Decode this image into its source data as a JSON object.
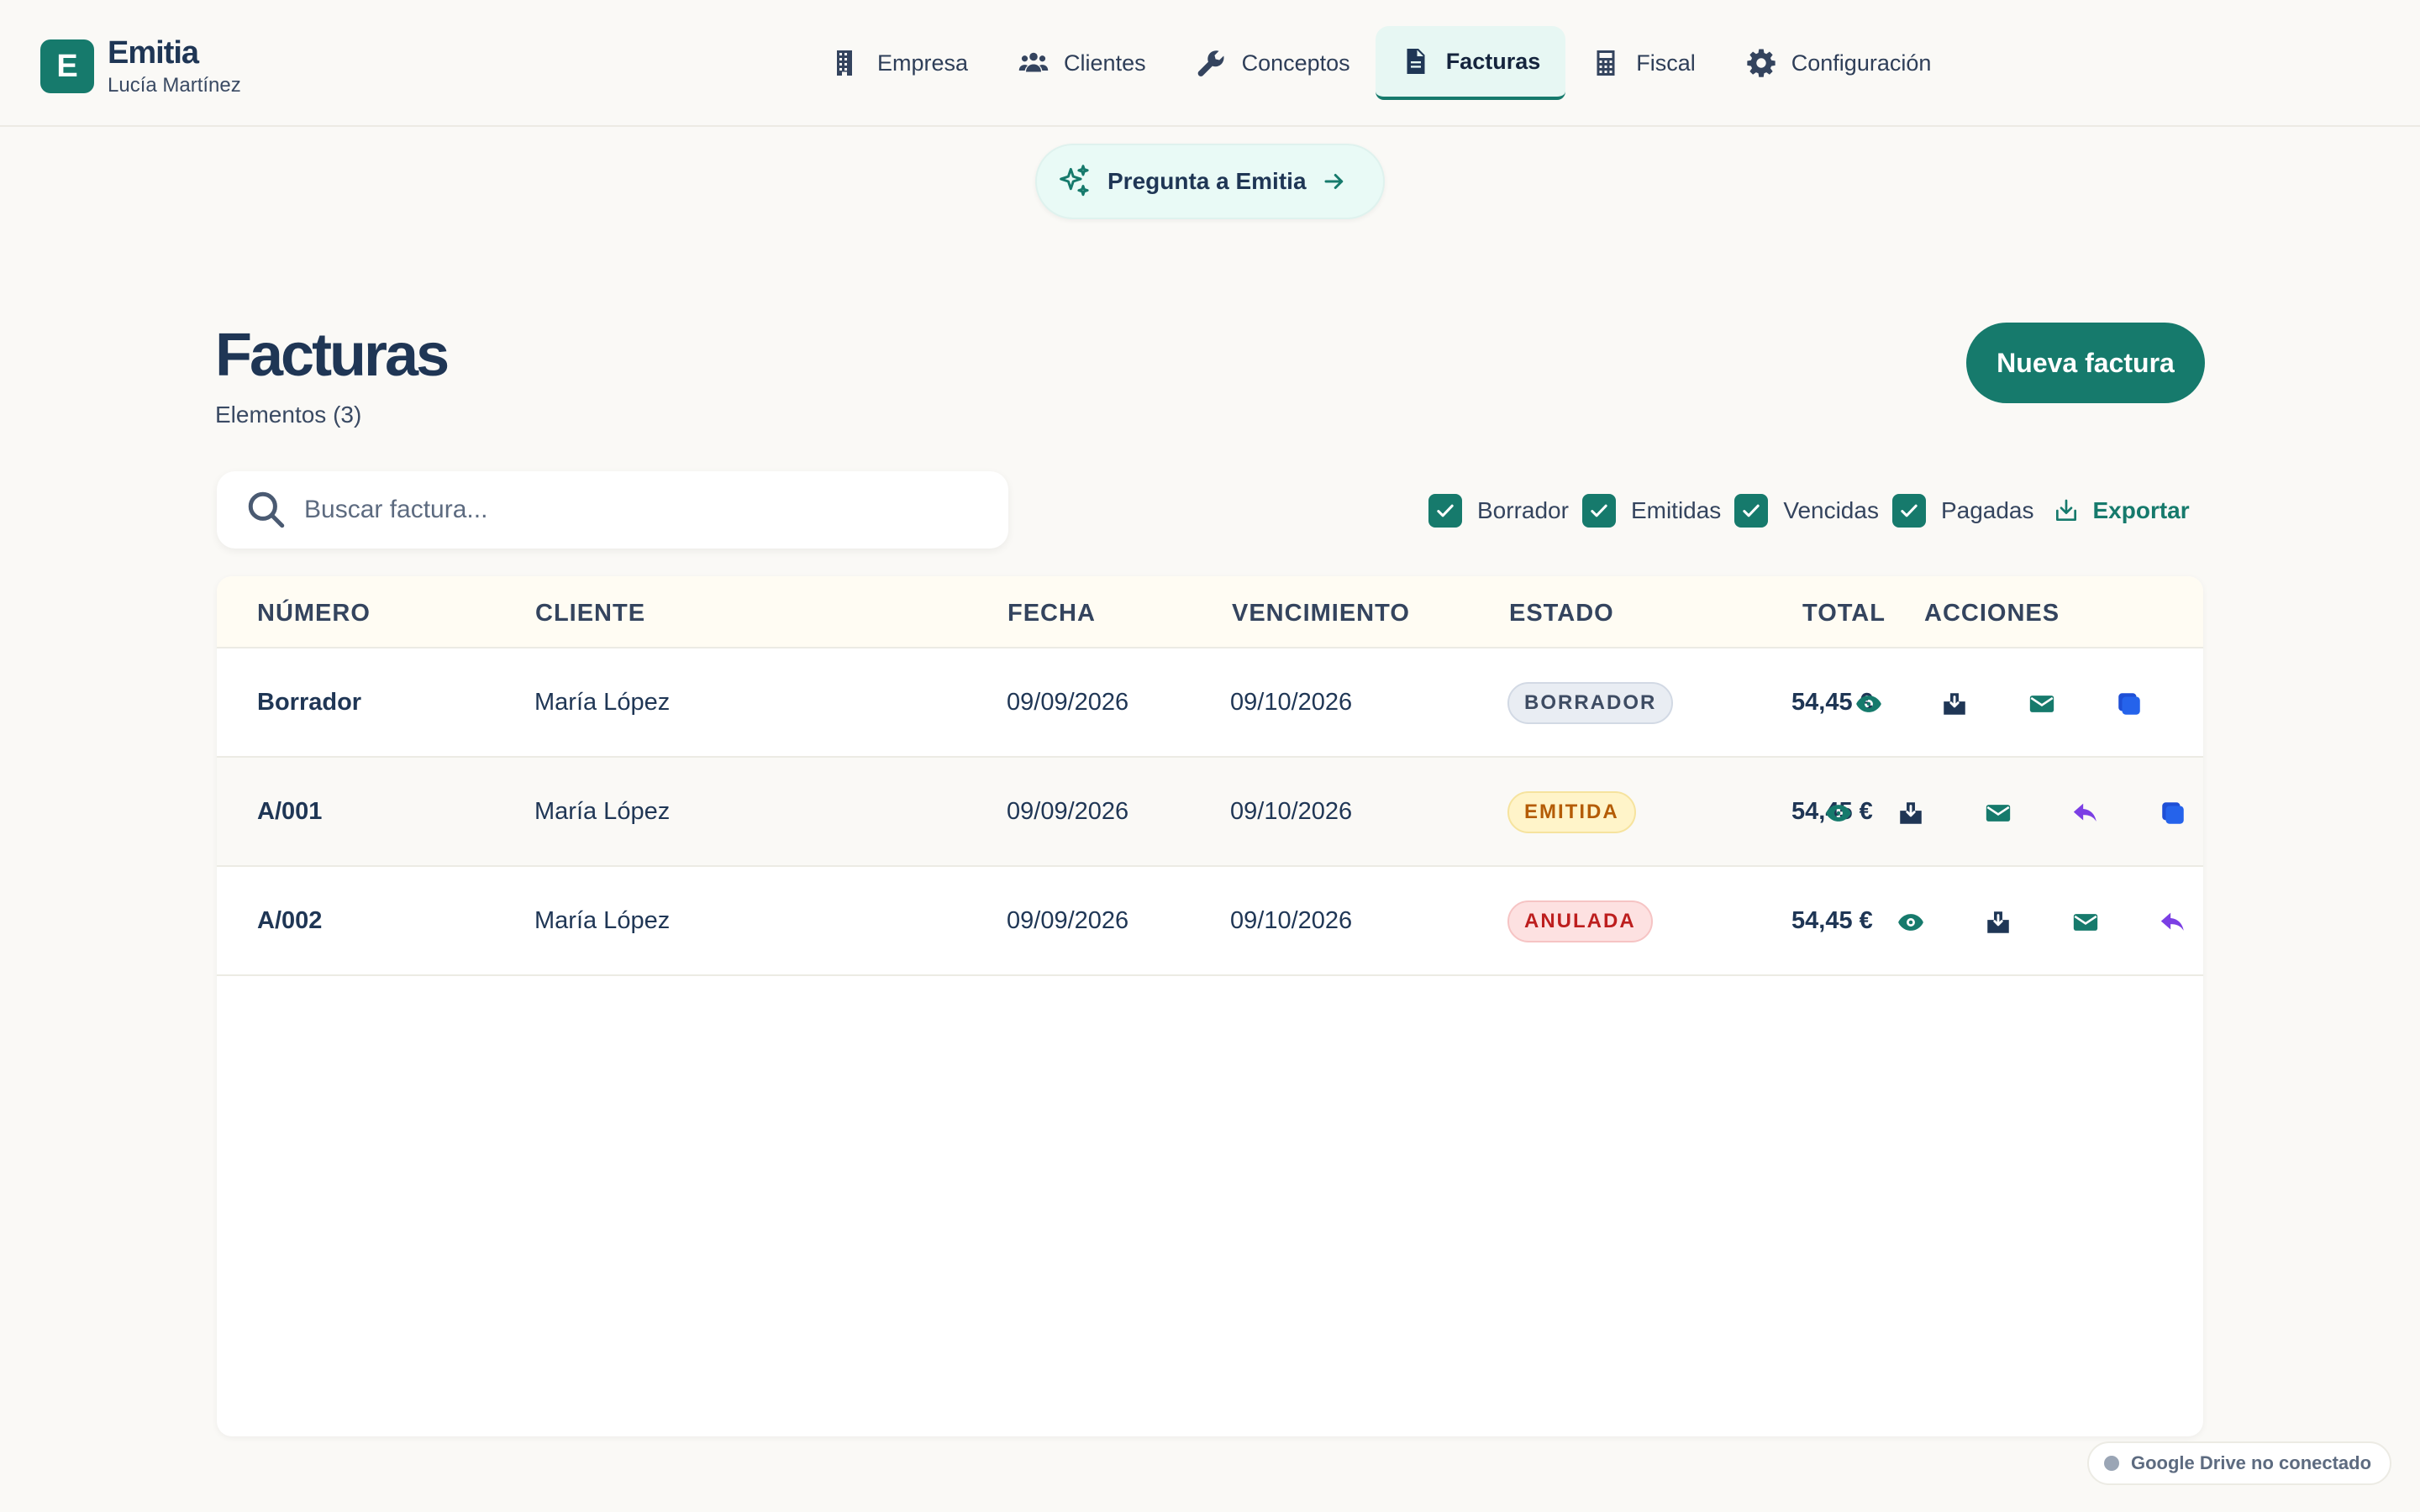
{
  "app": {
    "logo_letter": "E",
    "name": "Emitia",
    "user": "Lucía Martínez"
  },
  "nav": [
    {
      "label": "Empresa",
      "icon": "building-icon",
      "active": false
    },
    {
      "label": "Clientes",
      "icon": "users-icon",
      "active": false
    },
    {
      "label": "Conceptos",
      "icon": "wrench-icon",
      "active": false
    },
    {
      "label": "Facturas",
      "icon": "document-icon",
      "active": true
    },
    {
      "label": "Fiscal",
      "icon": "calculator-icon",
      "active": false
    },
    {
      "label": "Configuración",
      "icon": "gear-icon",
      "active": false
    }
  ],
  "ask": {
    "label": "Pregunta a Emitia"
  },
  "page": {
    "title": "Facturas",
    "count": "Elementos (3)",
    "new_button": "Nueva factura"
  },
  "search": {
    "placeholder": "Buscar factura...",
    "value": ""
  },
  "filters": [
    {
      "label": "Borrador",
      "checked": true
    },
    {
      "label": "Emitidas",
      "checked": true
    },
    {
      "label": "Vencidas",
      "checked": true
    },
    {
      "label": "Pagadas",
      "checked": true
    }
  ],
  "export": {
    "label": "Exportar"
  },
  "table": {
    "headers": {
      "numero": "NÚMERO",
      "cliente": "CLIENTE",
      "fecha": "FECHA",
      "vencimiento": "VENCIMIENTO",
      "estado": "ESTADO",
      "total": "TOTAL",
      "acciones": "ACCIONES"
    },
    "rows": [
      {
        "numero": "Borrador",
        "cliente": "María López",
        "fecha": "09/09/2026",
        "vencimiento": "09/10/2026",
        "estado": "BORRADOR",
        "total": "54,45 €"
      },
      {
        "numero": "A/001",
        "cliente": "María López",
        "fecha": "09/09/2026",
        "vencimiento": "09/10/2026",
        "estado": "EMITIDA",
        "total": "54,45 €"
      },
      {
        "numero": "A/002",
        "cliente": "María López",
        "fecha": "09/09/2026",
        "vencimiento": "09/10/2026",
        "estado": "ANULADA",
        "total": "54,45 €"
      }
    ]
  },
  "colors": {
    "accent": "#167a6c",
    "navy": "#1f3655",
    "purple": "#7b3fe4",
    "blue": "#2563eb"
  },
  "drive": {
    "status": "Google Drive no conectado"
  }
}
